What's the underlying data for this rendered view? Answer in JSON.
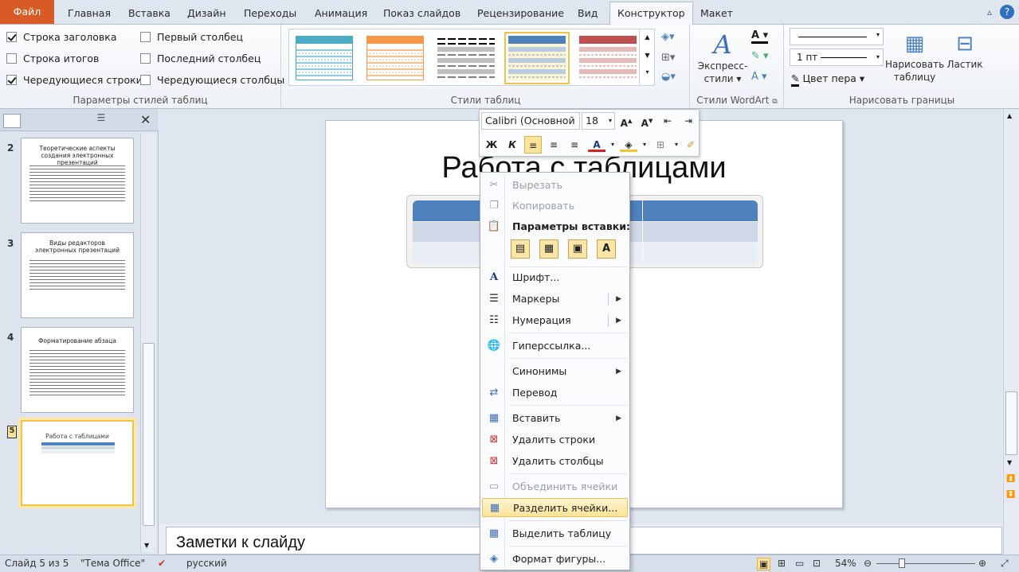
{
  "tabs": [
    "Файл",
    "Главная",
    "Вставка",
    "Дизайн",
    "Переходы",
    "Анимация",
    "Показ слайдов",
    "Рецензирование",
    "Вид",
    "Конструктор",
    "Макет"
  ],
  "active_tab": "Конструктор",
  "ribbon": {
    "style_options": {
      "label": "Параметры стилей таблиц",
      "header_row": "Строка заголовка",
      "total_row": "Строка итогов",
      "banded_rows": "Чередующиеся строки",
      "first_column": "Первый столбец",
      "last_column": "Последний столбец",
      "banded_columns": "Чередующиеся столбцы",
      "checked": {
        "header_row": true,
        "total_row": false,
        "banded_rows": true,
        "first_column": false,
        "last_column": false,
        "banded_columns": false
      }
    },
    "table_styles": {
      "label": "Стили таблиц",
      "colors": [
        "#4bacc6",
        "#f79646",
        "#000000",
        "#4f81bd",
        "#c0504d"
      ],
      "selected_index": 3
    },
    "wordart": {
      "label": "Стили WordArt",
      "express_1": "Экспресс-",
      "express_2": "стили"
    },
    "borders": {
      "label": "Нарисовать границы",
      "weight": "1 пт",
      "pen_color": "Цвет пера",
      "draw_table_1": "Нарисовать",
      "draw_table_2": "таблицу",
      "eraser": "Ластик"
    }
  },
  "slides_panel": {
    "thumbs": [
      {
        "num": "2",
        "title": "Теоретические аспекты создания электронных презентаций"
      },
      {
        "num": "3",
        "title": "Виды редакторов электронных презентаций"
      },
      {
        "num": "4",
        "title": "Форматирование абзаца"
      },
      {
        "num": "5",
        "title": "Работа с таблицами"
      }
    ]
  },
  "slide": {
    "title": "Работа с таблицами"
  },
  "notes": {
    "placeholder": "Заметки к слайду"
  },
  "minibar": {
    "font": "Calibri (Основной",
    "size": "18",
    "bold": "Ж",
    "italic": "К"
  },
  "context_menu": {
    "cut": "Вырезать",
    "copy": "Копировать",
    "paste_options": "Параметры вставки:",
    "font": "Шрифт...",
    "bullets": "Маркеры",
    "numbering": "Нумерация",
    "hyperlink": "Гиперссылка...",
    "synonyms": "Синонимы",
    "translate": "Перевод",
    "insert": "Вставить",
    "delete_rows": "Удалить строки",
    "delete_columns": "Удалить столбцы",
    "merge_cells": "Объединить ячейки",
    "split_cells": "Разделить ячейки...",
    "select_table": "Выделить таблицу",
    "format_shape": "Формат фигуры..."
  },
  "status": {
    "slide_info": "Слайд 5 из 5",
    "theme": "\"Тема Office\"",
    "language": "русский",
    "zoom": "54%",
    "zoom_level": 0.54
  },
  "colors": {
    "file_tab": "#d85b25",
    "table_header": "#4f81bd",
    "table_band": "#d0d8e8",
    "highlight": "#fde49a"
  }
}
